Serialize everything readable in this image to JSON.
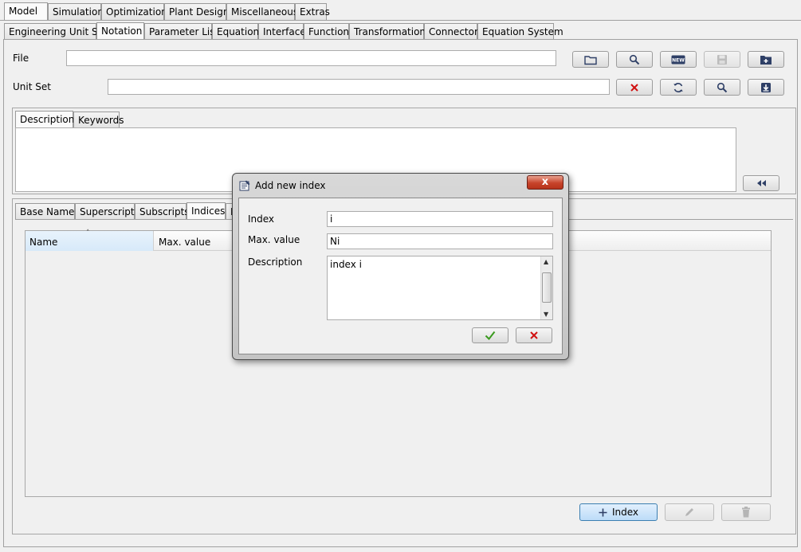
{
  "main_tabs": [
    "Model",
    "Simulation",
    "Optimization",
    "Plant Design",
    "Miscellaneous",
    "Extras"
  ],
  "sub_tabs": [
    "Engineering Unit Set",
    "Notation",
    "Parameter List",
    "Equation",
    "Interface",
    "Function",
    "Transformation",
    "Connector",
    "Equation System"
  ],
  "file_row": {
    "label": "File",
    "value": ""
  },
  "unit_set_row": {
    "label": "Unit Set",
    "value": ""
  },
  "desc_tabs": [
    "Description",
    "Keywords"
  ],
  "notation_tabs": [
    "Base Names",
    "Superscripts",
    "Subscripts",
    "Indices",
    "E"
  ],
  "table": {
    "columns": [
      "Name",
      "Max. value"
    ]
  },
  "bottom_buttons": {
    "add_index": "Index"
  },
  "icons": {
    "open": "folder-icon",
    "search": "search-icon",
    "new": "new-icon",
    "save": "save-icon",
    "add": "add-file-icon",
    "delete": "x-icon",
    "refresh": "refresh-icon",
    "import": "import-icon",
    "collapse": "rewind-icon",
    "edit": "pencil-icon",
    "trash": "trash-icon",
    "plus": "plus-icon",
    "ok": "check-icon",
    "cancel": "x-icon"
  },
  "dialog": {
    "title": "Add new index",
    "close": "x",
    "index_label": "Index",
    "index_value": "i",
    "maxvalue_label": "Max. value",
    "maxvalue_value": "Ni",
    "description_label": "Description",
    "description_value": "index i"
  },
  "colors": {
    "accent_button": "#c9e3fb",
    "close_red": "#c7432a",
    "ok_green": "#3a9a1e",
    "cancel_red": "#d01010"
  }
}
